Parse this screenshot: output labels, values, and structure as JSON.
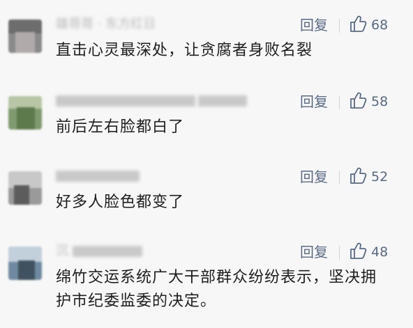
{
  "comments": [
    {
      "name": "雄哥哥 · 东方红日",
      "text": "直击心灵最深处，让贪腐者身败名裂",
      "reply": "回复",
      "likes": "68"
    },
    {
      "name": "",
      "text": "前后左右脸都白了",
      "reply": "回复",
      "likes": "58"
    },
    {
      "name": "",
      "text": "好多人脸色都变了",
      "reply": "回复",
      "likes": "52"
    },
    {
      "name": "沉",
      "text": "绵竹交运系统广大干部群众纷纷表示，坚决拥护市纪委监委的决定。",
      "reply": "回复",
      "likes": "48"
    }
  ],
  "icons": {
    "like": "thumbs-up-icon"
  },
  "colors": {
    "accent": "#5a6a85",
    "text": "#1e1e1e",
    "background": "#f7f7f7"
  }
}
